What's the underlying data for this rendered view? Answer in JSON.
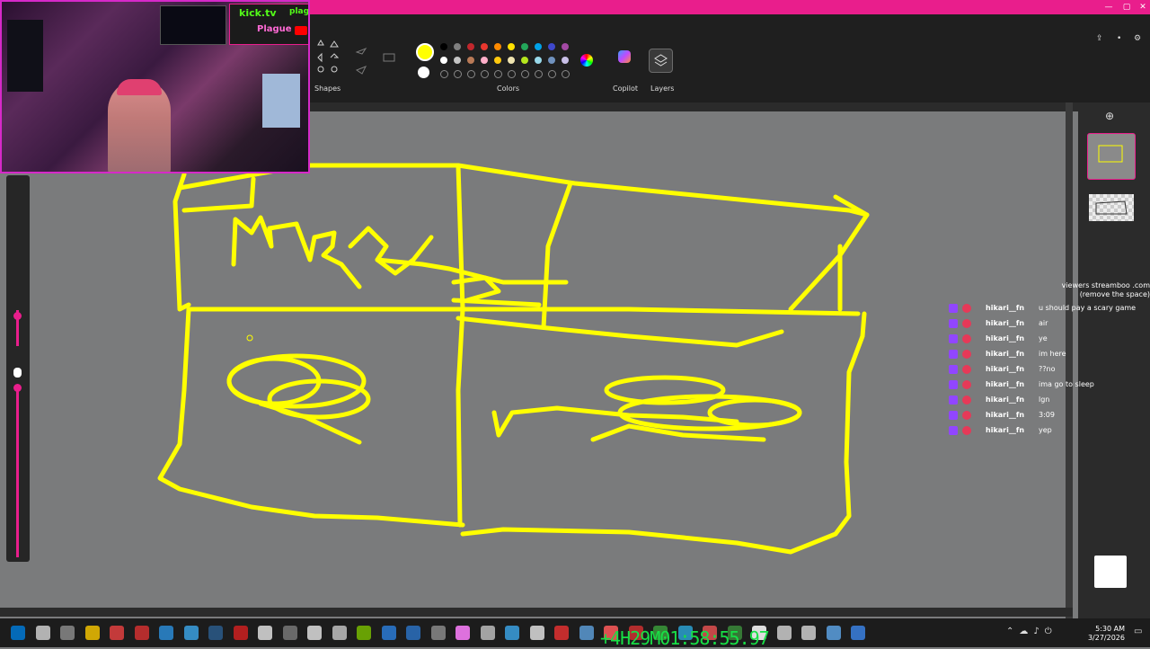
{
  "ribbon": {
    "shapes_label": "Shapes",
    "colors_label": "Colors",
    "copilot_label": "Copilot",
    "layers_label": "Layers",
    "palette_row1": [
      "#000000",
      "#7f7f7f",
      "#c1272d",
      "#e8372e",
      "#ff8a00",
      "#ffe000",
      "#23a65a",
      "#00a2e8",
      "#3f48cc",
      "#a349a4"
    ],
    "palette_row2": [
      "#ffffff",
      "#c3c3c3",
      "#b97a57",
      "#ffaec9",
      "#ffc90e",
      "#efe4b0",
      "#b5e61d",
      "#99d9ea",
      "#7092be",
      "#c8bfe7"
    ],
    "selected_color": "#ffff00"
  },
  "webcam": {
    "kick_line": "kick.tv",
    "kick_tag": "plag",
    "game_line": "Plague"
  },
  "overlay": {
    "viewers_line1": "viewers streamboo .com",
    "viewers_line2": "(remove the space)"
  },
  "chat": [
    {
      "user": "hikari__fn",
      "msg": "u should pay a scary game"
    },
    {
      "user": "hikari__fn",
      "msg": "air"
    },
    {
      "user": "hikari__fn",
      "msg": "ye"
    },
    {
      "user": "hikari__fn",
      "msg": "im here"
    },
    {
      "user": "hikari__fn",
      "msg": "??no"
    },
    {
      "user": "hikari__fn",
      "msg": "ima go to sleep"
    },
    {
      "user": "hikari__fn",
      "msg": "lgn"
    },
    {
      "user": "hikari__fn",
      "msg": "3:09"
    },
    {
      "user": "hikari__fn",
      "msg": "yep"
    }
  ],
  "timer": "+4H29M01:58:55.97",
  "clock": {
    "time": "5:30 AM",
    "date": "3/27/2026"
  },
  "colors": {
    "accent": "#e91e8c",
    "stroke": "#ffff00",
    "canvas": "#7a7b7c"
  }
}
